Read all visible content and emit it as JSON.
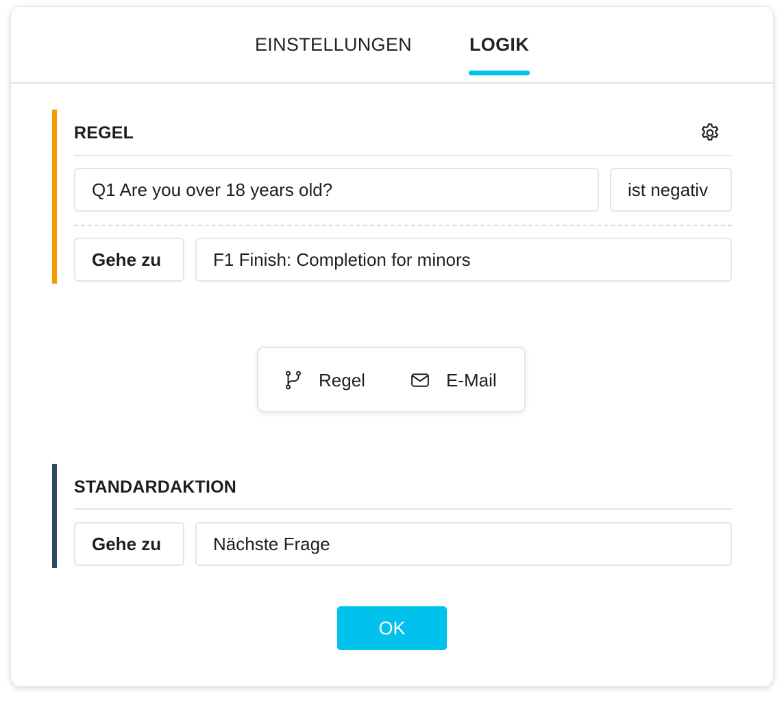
{
  "tabs": [
    {
      "label": "EINSTELLUNGEN",
      "active": false
    },
    {
      "label": "LOGIK",
      "active": true
    }
  ],
  "colors": {
    "accent": "#00c2e8",
    "rule_bar": "#f59a00",
    "default_bar": "#2c4a5e",
    "ok_button": "#00c2ec"
  },
  "rule": {
    "title": "REGEL",
    "settings_icon": "gear-icon",
    "condition": {
      "question": "Q1 Are you over 18 years old?",
      "operator": "ist negativ"
    },
    "action": {
      "label": "Gehe zu",
      "target": "F1 Finish: Completion for minors"
    }
  },
  "add_menu": {
    "items": [
      {
        "label": "Regel",
        "icon": "branch-icon"
      },
      {
        "label": "E-Mail",
        "icon": "envelope-icon"
      }
    ]
  },
  "default_action": {
    "title": "STANDARDAKTION",
    "label": "Gehe zu",
    "target": "Nächste Frage"
  },
  "ok_button": {
    "label": "OK"
  }
}
